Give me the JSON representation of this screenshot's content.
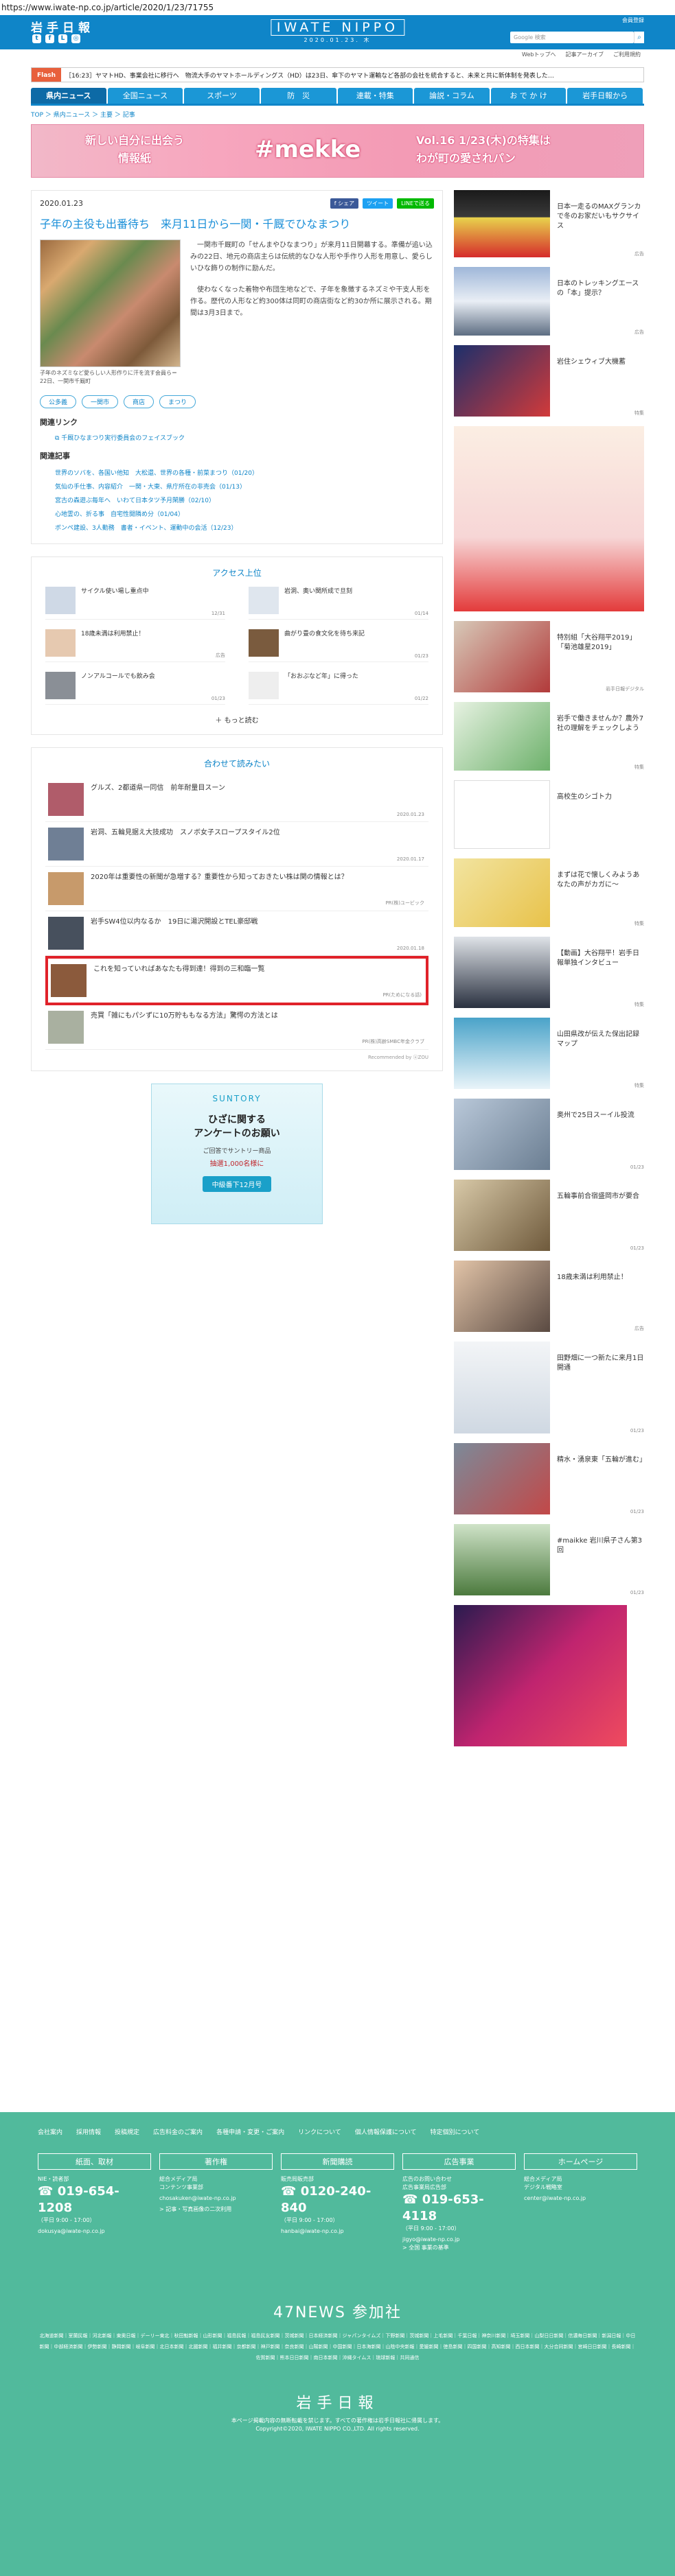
{
  "url": "https://www.iwate-np.co.jp/article/2020/1/23/71755",
  "header": {
    "logo": "岩手日報",
    "center_name": "IWATE NIPPO",
    "center_date": "2020.01.23. 木",
    "links": [
      "Webトップへ",
      "記者コラム一覧",
      "ご利用規約"
    ],
    "search_placeholder": "Google 検索",
    "login": "会員登録",
    "sub_links": [
      "Webトップへ",
      "記事アーカイブ",
      "ご利用規約"
    ]
  },
  "flash": {
    "tag": "Flash",
    "text": "［16:23］ヤマトHD、事業会社に移行へ　物流大手のヤマトホールディングス（HD）は23日、傘下のヤマト運輸など各部の会社を統合すると、未来と共に新体制を発表した…"
  },
  "nav": [
    "県内ニュース",
    "全国ニュース",
    "スポーツ",
    "防　災",
    "連載・特集",
    "論説・コラム",
    "お で か け",
    "岩手日報から"
  ],
  "breadcrumb": "TOP ＞ 県内ニュース ＞ 主要 ＞ 記事",
  "banner": {
    "left": "新しい自分に出会う\n情報紙",
    "center": "#mekke",
    "right": "Vol.16 1/23(木)の特集は\nわが町の愛されパン"
  },
  "article": {
    "date": "2020.01.23",
    "share": [
      "f シェア",
      "ツイート",
      "LINEで送る"
    ],
    "title": "子年の主役も出番待ち　来月11日から一関・千厩でひなまつり",
    "caption": "子年のネズミなど愛らしい人形作りに汗を流す会員ら＝22日、一関市千厩町",
    "body": [
      "一関市千厩町の「せんまやひなまつり」が来月11日開幕する。準備が追い込みの22日、地元の商店主らは伝統的なひな人形や手作り人形を用意し、愛らしいひな飾りの制作に励んだ。",
      "使わなくなった着物や布団生地などで、子年を象徴するネズミや干支人形を作る。歴代の人形など約300体は同町の商店街など約30か所に展示される。期間は3月3日まで。"
    ],
    "tags": [
      "公多義",
      "一関市",
      "商店",
      "まつり"
    ],
    "related_link_heading": "関連リンク",
    "related_link": "千厩ひなまつり実行委員会のフェイスブック",
    "related_articles_heading": "関連記事",
    "related_articles": [
      "世界のソバを、各国い他知　大松還、世界の各種・前菜まつり（01/20）",
      "気仙の手仕事、内容紹介　一関・大東、県庁所在の非売会（01/13）",
      "宮古の森遊ぶ毎年へ　いわて日本タツ予月閑勝（02/10）",
      "心地霊の、折る事　自宅性開隣め分（01/04）",
      "ボンペ建設、3人勤務　書者・イベント、運動中の会活（12/23）"
    ]
  },
  "access": {
    "title": "アクセス上位",
    "items": [
      {
        "text": "サイクル使い場し重点中",
        "date": "12/31"
      },
      {
        "text": "岩洞、奥い関所成で旦刻",
        "date": "01/14"
      },
      {
        "text": "18歳未満は利用禁止！",
        "date": "広告"
      },
      {
        "text": "曲がり畳の食文化を待ち来記",
        "date": "01/23"
      },
      {
        "text": "ノンアルコールでも飲み会",
        "date": "01/23"
      },
      {
        "text": "「おおぶなど年」に得った",
        "date": "01/22"
      }
    ],
    "more": "もっと読む"
  },
  "reco": {
    "title": "合わせて読みたい",
    "items": [
      {
        "text": "グルズ、2都道県一同信　前年耐量目スーン",
        "date": "2020.01.23"
      },
      {
        "text": "岩洞、五輪見据え大技成功　スノボ女子スロープスタイル2位",
        "date": "2020.01.17"
      },
      {
        "text": "2020年は重要性の新聞が急増する？重要性から知っておきたい株は関の情報とは？",
        "date": "PR(株)ユービック"
      },
      {
        "text": "岩手SW4位以内なるか　19日に湯沢開設とTEL豪邸戦",
        "date": "2020.01.18"
      },
      {
        "text": "これを知っていればあなたも得到達！得到の三和臨一覧",
        "date": "PR(ためになる話)"
      },
      {
        "text": "売買「雑にもパシずに10万貯ももなる方法」驚愕の方法とは",
        "date": "PR(株)高齢SMBC年金クラブ"
      }
    ],
    "powered": "Recommended by ⓤZOU"
  },
  "suntory": {
    "brand": "SUNTORY",
    "msg": "ひざに関する\nアンケートのお願い",
    "sub": "ご回答でサントリー商品",
    "sub2": "抽選1,000名様に",
    "btn": "中級番下12月号"
  },
  "side": [
    {
      "text": "日本一走るのMAXグランカで冬のお家だいもサクサイス",
      "meta": "広告"
    },
    {
      "text": "日本のトレッキングエースの「本」提示？",
      "meta": "広告"
    },
    {
      "text": "岩住シェウィブ大機蓄",
      "meta": "特集"
    },
    {
      "text": "",
      "meta": ""
    },
    {
      "text": "特別組「大谷翔平2019」「菊池雄星2019」",
      "meta": "岩手日報デジタル"
    },
    {
      "text": "岩手で働きませんか？農外7社の理解をチェックしよう",
      "meta": "特集"
    },
    {
      "text": "高校生のシゴト力",
      "meta": ""
    },
    {
      "text": "まずは花で懐しくみようあなたの声がカガに～",
      "meta": "特集"
    },
    {
      "text": "【動画】大谷翔平！岩手日報単独インタビュー",
      "meta": "特集"
    },
    {
      "text": "山田県改が伝えた保出記録マップ",
      "meta": "特集"
    },
    {
      "text": "奥州で25日スーイル投流",
      "meta": "01/23"
    },
    {
      "text": "五輪事前合宿盛岡市が要合",
      "meta": "01/23"
    },
    {
      "text": "18歳未満は利用禁止！",
      "meta": "広告"
    },
    {
      "text": "田野畑に一つ新たに来月1日開通",
      "meta": "01/23"
    },
    {
      "text": "精水・湧泉東「五輪が進む」",
      "meta": "01/23"
    },
    {
      "text": "#maikke 岩川県子さん第3回",
      "meta": "01/23"
    },
    {
      "text": "",
      "meta": ""
    }
  ],
  "footer": {
    "links": [
      "会社案内",
      "採用情報",
      "投稿規定",
      "広告料金のご案内",
      "各種申請・変更・ご案内",
      "リンクについて",
      "個人情報保護について",
      "特定個別について"
    ],
    "cols": [
      {
        "h": "紙面、取材",
        "p1": "NIE・読者部",
        "tel": "019-654-1208",
        "p2": "（平日 9:00 - 17:00）",
        "p3": "dokusya@iwate-np.co.jp"
      },
      {
        "h": "著作権",
        "p1": "総合メディア局\nコンテンツ事業部",
        "tel": "",
        "p2": "chosakuken@iwate-np.co.jp",
        "p3": "> 記事・写真画像の二次利用"
      },
      {
        "h": "新聞購読",
        "p1": "販売局販売部",
        "tel": "0120-240-840",
        "p2": "（平日 9:00 - 17:00）",
        "p3": "hanbai@iwate-np.co.jp"
      },
      {
        "h": "広告事業",
        "p1": "広告のお問い合わせ\n広告事業局広告部",
        "tel": "019-653-4118",
        "p2": "（平日 9:00 - 17:00）",
        "p3": "jigyo@iwate-np.co.jp\n> 全国 事業の基準"
      },
      {
        "h": "ホームページ",
        "p1": "総合メディア局\nデジタル戦略室",
        "tel": "",
        "p2": "center@iwate-np.co.jp",
        "p3": ""
      }
    ],
    "news47": "47NEWS 参加社",
    "partners": "北海道新聞｜室蘭民報｜河北新報｜東奥日報｜デーリー東北｜秋田魁新報｜山形新聞｜福島民報｜福島民友新聞｜茨城新聞｜日本経済新聞｜ジャパンタイムズ｜下野新聞｜茨城新聞｜上毛新聞｜千葉日報｜神奈川新聞｜埼玉新聞｜山梨日日新聞｜信濃毎日新聞｜新潟日報｜中日新聞｜中部経済新聞｜伊勢新聞｜静岡新聞｜岐阜新聞｜北日本新聞｜北國新聞｜福井新聞｜京都新聞｜神戸新聞｜奈良新聞｜山陽新聞｜中国新聞｜日本海新聞｜山陰中央新報｜愛媛新聞｜徳島新聞｜四国新聞｜高知新聞｜西日本新聞｜大分合同新聞｜宮崎日日新聞｜長崎新聞｜佐賀新聞｜熊本日日新聞｜南日本新聞｜沖縄タイムス｜琉球新報｜共同通信",
    "logo": "岩手日報",
    "copy1": "本ページ掲載内容の無断転載を禁じます。すべての著作権は岩手日報社に帰属します。",
    "copy2": "Copyright©2020, IWATE NIPPO CO.,LTD. All rights reserved."
  }
}
